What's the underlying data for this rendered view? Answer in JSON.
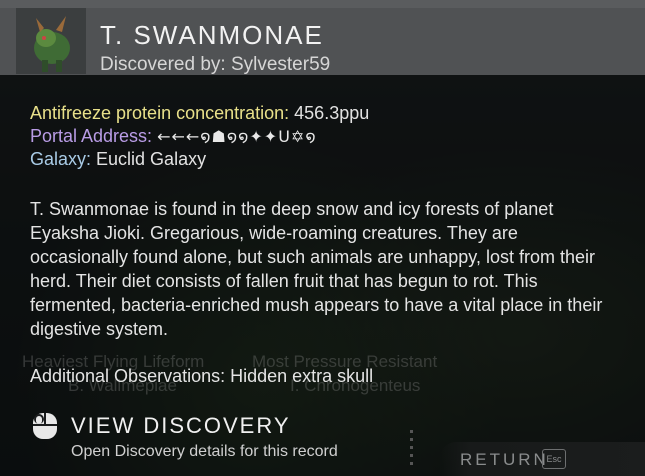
{
  "header": {
    "title": "T. SWANMONAE",
    "subtitle": "Discovered by: Sylvester59"
  },
  "details": {
    "antifreeze_label": "Antifreeze protein concentration:",
    "antifreeze_value": " 456.3ppu",
    "portal_label": "Portal Address:",
    "portal_glyphs": "←←←໑☗໑໑✦✦U✡໑",
    "galaxy_label": "Galaxy:",
    "galaxy_value": " Euclid Galaxy"
  },
  "description": "T. Swanmonae is found in the deep snow and icy forests of planet Eyaksha Jioki. Gregarious, wide-roaming creatures. They are occasionally found alone, but such animals are unhappy, lost from their herd. Their diet consists of fallen fruit that has begun to rot. This fermented, bacteria-enriched mush appears to have a vital place in their digestive system.",
  "observations": "Additional Observations: Hidden extra skull",
  "background_ghost": {
    "line1": "Heaviest Flying Lifeform",
    "line2": "Most Pressure Resistant",
    "line3": "B. Wallmepiae",
    "line4": "I. Chronogenteus"
  },
  "view_discovery": {
    "label": "VIEW DISCOVERY",
    "sublabel": "Open Discovery details for this record"
  },
  "return_button": {
    "label": "RETURN",
    "key": "Esc"
  },
  "colors": {
    "accent_yellow": "#e8e08a",
    "accent_purple": "#b99ce6",
    "accent_blue": "#a9cbe6"
  }
}
